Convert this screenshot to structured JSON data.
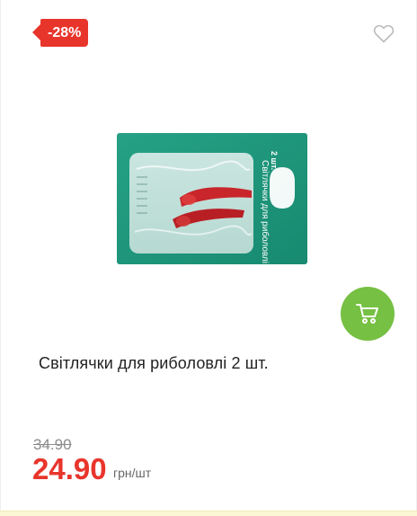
{
  "product": {
    "discount_badge": "-28%",
    "title": "Світлячки для риболовлі 2 шт.",
    "old_price": "34.90",
    "new_price": "24.90",
    "unit": "грн/шт",
    "package_text": "Світлячки для риболовлі",
    "package_count": "2 шт."
  },
  "icons": {
    "favorite": "heart-outline-icon",
    "cart": "shopping-cart-icon"
  },
  "colors": {
    "badge": "#e8352c",
    "price": "#e8352c",
    "cart_button": "#76c043",
    "package_green": "#1f9a7e"
  }
}
